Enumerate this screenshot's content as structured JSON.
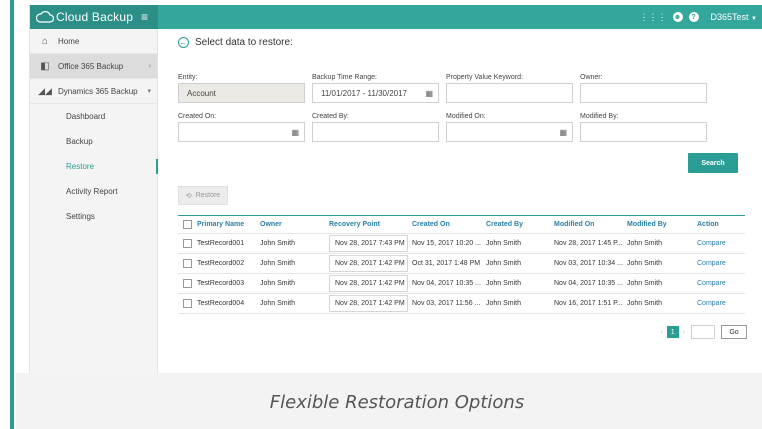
{
  "brand": {
    "name": "Cloud Backup",
    "menu_icon": "hamburger-icon"
  },
  "topbar": {
    "user": "D365Test"
  },
  "sidebar": {
    "items": [
      {
        "label": "Home",
        "icon": "home-icon"
      },
      {
        "label": "Office 365 Backup",
        "icon": "office-icon"
      },
      {
        "label": "Dynamics 365 Backup",
        "icon": "dynamics-icon"
      }
    ],
    "subitems": [
      {
        "label": "Dashboard"
      },
      {
        "label": "Backup"
      },
      {
        "label": "Restore"
      },
      {
        "label": "Activity Report"
      },
      {
        "label": "Settings"
      }
    ]
  },
  "main": {
    "title": "Select data to restore:",
    "filters": {
      "entity_label": "Entity:",
      "entity_value": "Account",
      "backup_range_label": "Backup Time Range:",
      "backup_range_value": "11/01/2017 - 11/30/2017",
      "keyword_label": "Property Value Keyword:",
      "owner_label": "Owner:",
      "created_on_label": "Created On:",
      "created_by_label": "Created By:",
      "modified_on_label": "Modified On:",
      "modified_by_label": "Modified By:"
    },
    "search_label": "Search",
    "restore_label": "Restore",
    "table": {
      "headers": [
        "Primary Name",
        "Owner",
        "Recovery Point",
        "Created On",
        "Created By",
        "Modified On",
        "Modified By",
        "Action"
      ],
      "rows": [
        [
          "TestRecord001",
          "John Smith",
          "Nov 28, 2017 7:43 PM",
          "Nov 15, 2017 10:20 ...",
          "John Smith",
          "Nov 28, 2017 1:45 P...",
          "John Smith",
          "Compare"
        ],
        [
          "TestRecord002",
          "John Smith",
          "Nov 28, 2017 1:42 PM",
          "Oct 31, 2017 1:48 PM",
          "John Smith",
          "Nov 03, 2017 10:34 ...",
          "John Smith",
          "Compare"
        ],
        [
          "TestRecord003",
          "John Smith",
          "Nov 28, 2017 1:42 PM",
          "Nov 04, 2017 10:35 ...",
          "John Smith",
          "Nov 04, 2017 10:35 ...",
          "John Smith",
          "Compare"
        ],
        [
          "TestRecord004",
          "John Smith",
          "Nov 28, 2017 1:42 PM",
          "Nov 03, 2017 11:56 ...",
          "John Smith",
          "Nov 16, 2017 1:51 P...",
          "John Smith",
          "Compare"
        ]
      ]
    },
    "pager": {
      "current": "1",
      "go_label": "Go"
    }
  },
  "caption": "Flexible Restoration Options"
}
